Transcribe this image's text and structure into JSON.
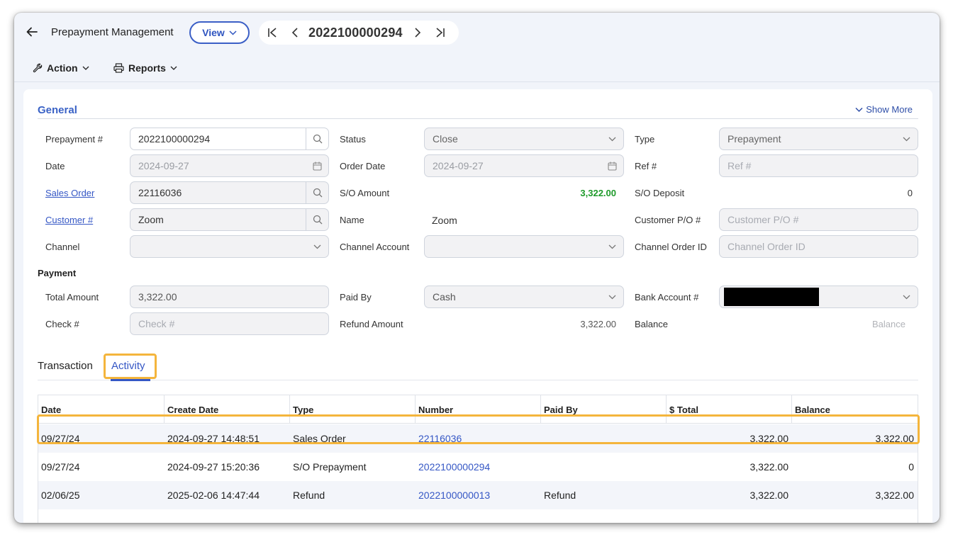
{
  "header": {
    "title": "Prepayment Management",
    "view_label": "View",
    "record_number": "2022100000294"
  },
  "toolbar": {
    "action_label": "Action",
    "reports_label": "Reports"
  },
  "general": {
    "section_title": "General",
    "show_more": "Show More",
    "prepayment_label": "Prepayment #",
    "prepayment_value": "2022100000294",
    "status_label": "Status",
    "status_value": "Close",
    "type_label": "Type",
    "type_value": "Prepayment",
    "date_label": "Date",
    "date_value": "2024-09-27",
    "order_date_label": "Order Date",
    "order_date_value": "2024-09-27",
    "ref_label": "Ref #",
    "ref_placeholder": "Ref #",
    "sales_order_label": "Sales Order",
    "sales_order_value": "22116036",
    "so_amount_label": "S/O Amount",
    "so_amount_value": "3,322.00",
    "so_deposit_label": "S/O Deposit",
    "so_deposit_value": "0",
    "customer_label": "Customer #",
    "customer_value": "Zoom",
    "name_label": "Name",
    "name_value": "Zoom",
    "customer_po_label": "Customer P/O #",
    "customer_po_placeholder": "Customer P/O #",
    "channel_label": "Channel",
    "channel_account_label": "Channel Account",
    "channel_order_label": "Channel Order ID",
    "channel_order_placeholder": "Channel Order ID"
  },
  "payment": {
    "section_title": "Payment",
    "total_amount_label": "Total Amount",
    "total_amount_value": "3,322.00",
    "paid_by_label": "Paid By",
    "paid_by_value": "Cash",
    "bank_account_label": "Bank Account #",
    "check_label": "Check #",
    "check_placeholder": "Check #",
    "refund_amount_label": "Refund Amount",
    "refund_amount_value": "3,322.00",
    "balance_label": "Balance",
    "balance_placeholder": "Balance"
  },
  "tabs": [
    {
      "label": "Transaction"
    },
    {
      "label": "Activity"
    }
  ],
  "table": {
    "columns": [
      "Date",
      "Create Date",
      "Type",
      "Number",
      "Paid By",
      "$ Total",
      "Balance"
    ],
    "rows": [
      {
        "date": "09/27/24",
        "create_date": "2024-09-27 14:48:51",
        "type": "Sales Order",
        "number": "22116036",
        "paid_by": "",
        "total": "3,322.00",
        "balance": "3,322.00"
      },
      {
        "date": "09/27/24",
        "create_date": "2024-09-27 15:20:36",
        "type": "S/O Prepayment",
        "number": "2022100000294",
        "paid_by": "",
        "total": "3,322.00",
        "balance": "0"
      },
      {
        "date": "02/06/25",
        "create_date": "2025-02-06 14:47:44",
        "type": "Refund",
        "number": "2022100000013",
        "paid_by": "Refund",
        "total": "3,322.00",
        "balance": "3,322.00"
      }
    ]
  },
  "colors": {
    "accent": "#3557c5",
    "highlight": "#f4b53c",
    "positive": "#1e9a2a"
  }
}
